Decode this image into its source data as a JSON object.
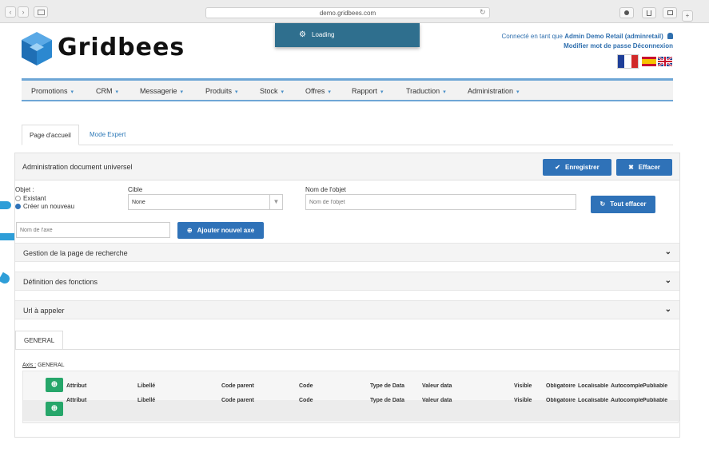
{
  "browser": {
    "url": "demo.gridbees.com",
    "nav_back": "‹",
    "nav_fwd": "›",
    "reload": "↻",
    "plus": "+"
  },
  "loading": {
    "label": "Loading"
  },
  "header": {
    "logo_text": "Gridbees",
    "connected_prefix": "Connecté en tant que",
    "user_name": "Admin Demo Retail (adminretail)",
    "change_password": "Modifier mot de passe",
    "logout": "Déconnexion"
  },
  "topnav": {
    "items": [
      "Promotions",
      "CRM",
      "Messagerie",
      "Produits",
      "Stock",
      "Offres",
      "Rapport",
      "Traduction",
      "Administration"
    ],
    "caret": "▾"
  },
  "tabs": {
    "home": "Page d'accueil",
    "expert": "Mode Expert"
  },
  "panel": {
    "title": "Administration document universel",
    "save_label": "Enregistrer",
    "clear_label": "Effacer",
    "object_label": "Objet :",
    "existing_label": "Existant",
    "create_new_label": "Créer un nouveau",
    "target_label": "Cible",
    "target_value": "None",
    "object_name_label": "Nom de l'objet",
    "object_name_placeholder": "Nom de l'objet",
    "clear_all_label": "Tout effacer",
    "axis_name_placeholder": "Nom de l'axe",
    "add_axis_label": "Ajouter nouvel axe"
  },
  "accordions": [
    "Gestion de la page de recherche",
    "Définition des fonctions",
    "Url à appeler"
  ],
  "subtab": {
    "general": "GENERAL"
  },
  "axis": {
    "prefix": "Axis :",
    "name": "GENERAL"
  },
  "grid": {
    "columns": [
      "Attribut",
      "Libellé",
      "Code parent",
      "Code",
      "Type de Data",
      "Valeur data",
      "Visible",
      "Obligatoire",
      "Localisable",
      "Autocomplete",
      "Publiable"
    ],
    "rows": 2
  },
  "colors": {
    "accent": "#2f72b8",
    "green": "#26a66a",
    "loading": "#2f6f8e",
    "nav_line": "#6ea6d6"
  }
}
